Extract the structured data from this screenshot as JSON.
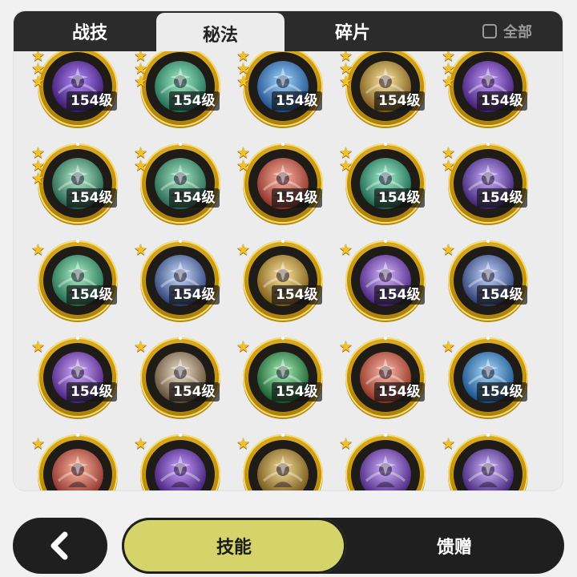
{
  "tabs": [
    {
      "label": "战技",
      "active": false
    },
    {
      "label": "秘法",
      "active": true
    },
    {
      "label": "碎片",
      "active": false
    }
  ],
  "show_all": {
    "label": "全部",
    "checked": false
  },
  "skills": [
    {
      "level": "154级",
      "stars": 3,
      "color_a": "#b48cff",
      "color_b": "#3a176e",
      "icon": "radiant-star-icon"
    },
    {
      "level": "154级",
      "stars": 3,
      "color_a": "#9ff0c7",
      "color_b": "#1e6b55",
      "icon": "leaf-shield-icon"
    },
    {
      "level": "154级",
      "stars": 3,
      "color_a": "#9fd6ff",
      "color_b": "#1d4e8c",
      "icon": "figure-swirl-icon"
    },
    {
      "level": "154级",
      "stars": 3,
      "color_a": "#ffe7a3",
      "color_b": "#7a5a16",
      "icon": "arrow-burst-icon"
    },
    {
      "level": "154级",
      "stars": 3,
      "color_a": "#c79cff",
      "color_b": "#3f1b75",
      "icon": "spiral-icon"
    },
    {
      "level": "154级",
      "stars": 3,
      "color_a": "#b8f0d2",
      "color_b": "#1f5c48",
      "icon": "crystal-cluster-icon"
    },
    {
      "level": "154级",
      "stars": 2,
      "color_a": "#a8eac8",
      "color_b": "#23654f",
      "icon": "shield-icon"
    },
    {
      "level": "154级",
      "stars": 2,
      "color_a": "#ffb7a5",
      "color_b": "#8c2e24",
      "icon": "figure-flame-icon"
    },
    {
      "level": "154级",
      "stars": 2,
      "color_a": "#a6f5d4",
      "color_b": "#16604a",
      "icon": "figure-glow-icon"
    },
    {
      "level": "154级",
      "stars": 2,
      "color_a": "#cfb4ff",
      "color_b": "#3b1f74",
      "icon": "figure-rise-icon"
    },
    {
      "level": "154级",
      "stars": 1,
      "color_a": "#aef1c9",
      "color_b": "#1c6a4c",
      "icon": "heart-icon"
    },
    {
      "level": "154级",
      "stars": 1,
      "color_a": "#cde0ff",
      "color_b": "#2a3f77",
      "icon": "sparkle-icon"
    },
    {
      "level": "154级",
      "stars": 1,
      "color_a": "#ffe6a0",
      "color_b": "#7d5b12",
      "icon": "wing-hand-icon"
    },
    {
      "level": "154级",
      "stars": 1,
      "color_a": "#d8b8ff",
      "color_b": "#46207e",
      "icon": "eye-pillar-icon"
    },
    {
      "level": "154级",
      "stars": 1,
      "color_a": "#c7d8ff",
      "color_b": "#283b73",
      "icon": "crystal-star-icon"
    },
    {
      "level": "154级",
      "stars": 1,
      "color_a": "#d3b0ff",
      "color_b": "#4a1f82",
      "icon": "heart-figure-icon"
    },
    {
      "level": "154级",
      "stars": 1,
      "color_a": "#f2e3cf",
      "color_b": "#5e4a32",
      "icon": "figure-arch-icon"
    },
    {
      "level": "154级",
      "stars": 1,
      "color_a": "#a8f2b9",
      "color_b": "#145a2b",
      "icon": "circuit-tower-icon"
    },
    {
      "level": "154级",
      "stars": 1,
      "color_a": "#ffb9a8",
      "color_b": "#8f3122",
      "icon": "fist-burst-icon"
    },
    {
      "level": "154级",
      "stars": 1,
      "color_a": "#a8dcff",
      "color_b": "#164e8a",
      "icon": "ice-spike-icon"
    },
    {
      "level": "",
      "stars": 1,
      "color_a": "#ffb8a0",
      "color_b": "#8a2f2a",
      "icon": "swirl-flame-icon"
    },
    {
      "level": "",
      "stars": 1,
      "color_a": "#caa4ff",
      "color_b": "#3e1876",
      "icon": "feather-icon"
    },
    {
      "level": "",
      "stars": 1,
      "color_a": "#f5dc98",
      "color_b": "#6f5215",
      "icon": "figure-gold-icon"
    },
    {
      "level": "",
      "stars": 1,
      "color_a": "#d2b2ff",
      "color_b": "#44207a",
      "icon": "fist-purple-icon"
    },
    {
      "level": "",
      "stars": 1,
      "color_a": "#d3b8ff",
      "color_b": "#3a1c6f",
      "icon": "eye-circle-icon"
    }
  ],
  "footer": {
    "back_icon": "chevron-left-icon",
    "primary_label": "技能",
    "secondary_label": "馈赠"
  }
}
